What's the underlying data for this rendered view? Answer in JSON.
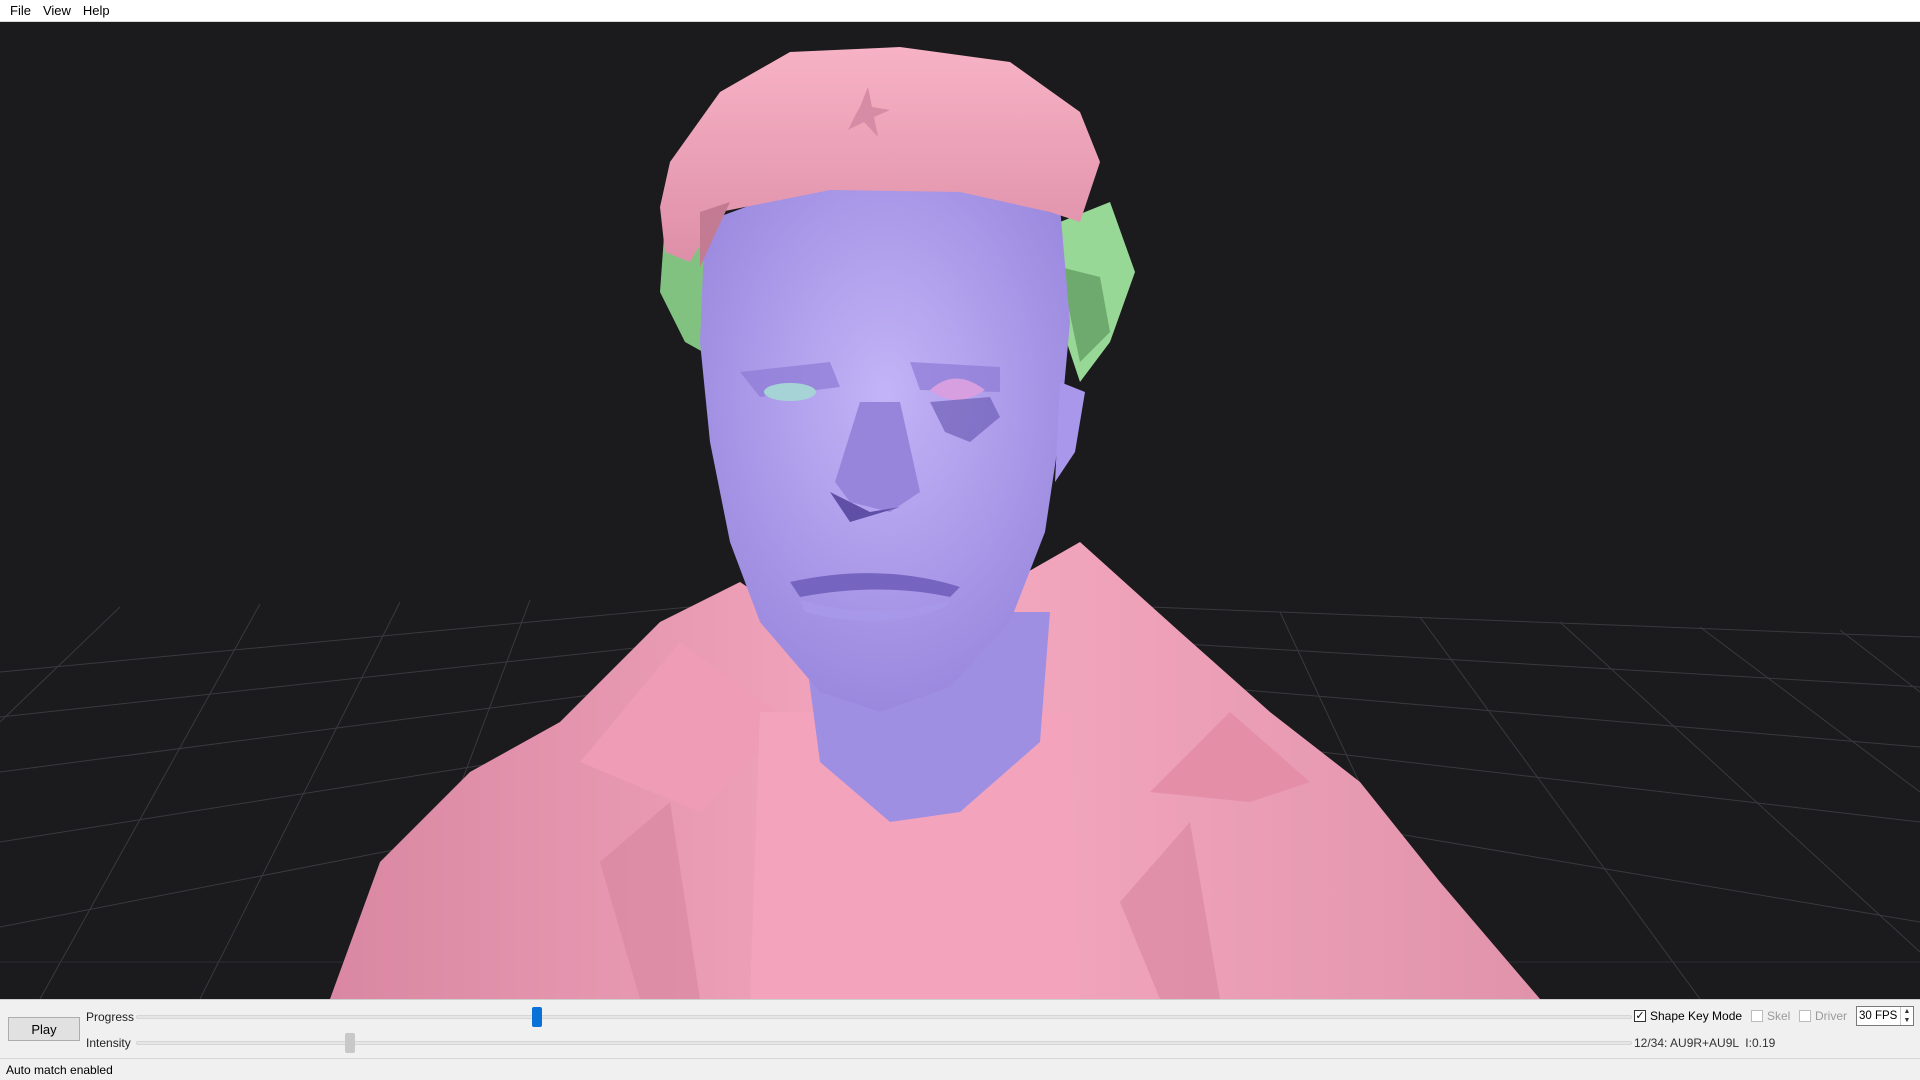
{
  "menu": {
    "items": [
      "File",
      "View",
      "Help"
    ]
  },
  "colors": {
    "viewport_bg": "#1b1a1d",
    "grid_line": "#3a3a3e",
    "clothing": "#f2a0b8",
    "skin": "#b3a2ee",
    "hair": "#90d08f",
    "progress_thumb": "#0a72d6"
  },
  "controls": {
    "play_label": "Play",
    "progress_label": "Progress",
    "intensity_label": "Intensity",
    "progress_value": 0.268,
    "intensity_value": 0.143,
    "shape_key_mode": {
      "label": "Shape Key Mode",
      "checked": true
    },
    "skel": {
      "label": "Skel",
      "checked": false
    },
    "driver": {
      "label": "Driver",
      "checked": false
    },
    "fps": {
      "value": "30 FPS"
    },
    "info": "12/34: AU9R+AU9L  I:0.19"
  },
  "status": {
    "text": "Auto match enabled"
  }
}
